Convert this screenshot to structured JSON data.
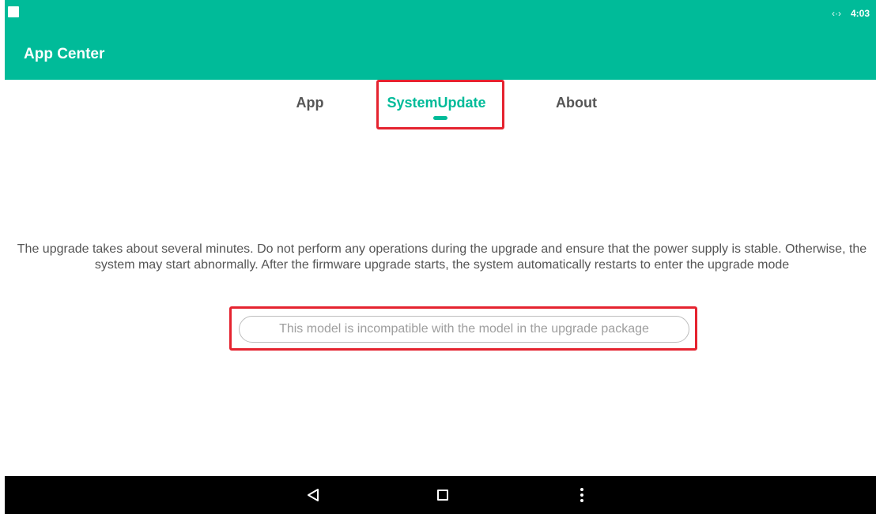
{
  "status_bar": {
    "time": "4:03",
    "left_icon": "notification-square-icon",
    "right_icon": "code-arrows-icon"
  },
  "app_bar": {
    "title": "App Center"
  },
  "tabs": [
    {
      "label": "App",
      "active": false
    },
    {
      "label": "SystemUpdate",
      "active": true
    },
    {
      "label": "About",
      "active": false
    }
  ],
  "system_update": {
    "description": "The upgrade takes about several minutes. Do not perform any operations during the upgrade and ensure that the power supply is stable. Otherwise, the system may start abnormally. After the firmware upgrade starts, the system automatically restarts to enter the upgrade mode",
    "status_message": "This model is incompatible with the model in the upgrade package"
  },
  "nav_bar": {
    "back_icon": "back-triangle-icon",
    "home_icon": "home-square-icon",
    "menu_icon": "overflow-dots-icon"
  },
  "colors": {
    "accent": "#00bb99",
    "highlight": "#e5232f",
    "text": "#555555",
    "muted": "#9e9e9e",
    "nav_bg": "#000000"
  }
}
